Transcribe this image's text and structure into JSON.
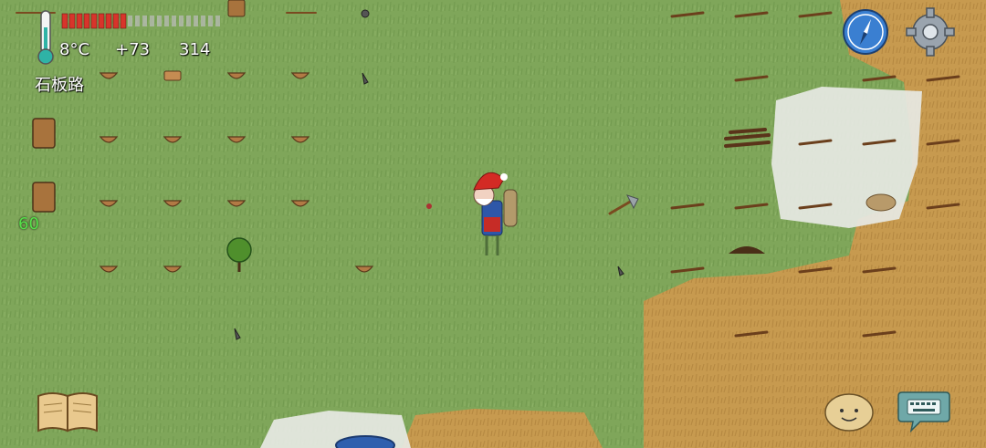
{
  "hud": {
    "temperature": "8°C",
    "yum_bonus": "+73",
    "score": "314",
    "biome_label": "石板路",
    "age": "60"
  },
  "colors": {
    "grassland": "#7fa65a",
    "grass_dark": "#6b9448",
    "desert": "#c79a4f",
    "snow": "#e7e9e4",
    "water": "#2f5fae",
    "hunger_bar_fill": "#d8342b",
    "hunger_bar_empty": "#bdbdbd",
    "compass_blue": "#3a7fd1"
  },
  "icons": {
    "thermometer": "thermometer-icon",
    "compass": "compass-icon",
    "settings": "gear-icon",
    "recipe_book": "book-icon",
    "emote": "face-icon",
    "chat": "keyboard-icon"
  }
}
